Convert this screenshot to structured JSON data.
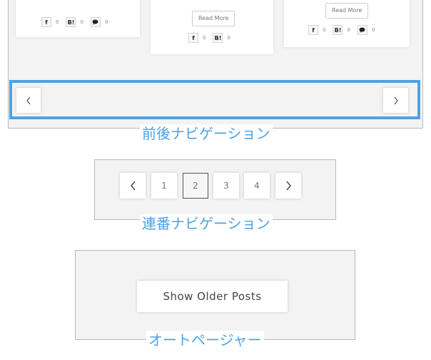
{
  "section_prev_next": {
    "caption": "前後ナビゲーション",
    "cards": [
      {
        "share": [
          {
            "icon": "f",
            "count": "0"
          },
          {
            "icon": "B!",
            "count": "0"
          },
          {
            "icon": "speech-bubble",
            "count": "0"
          }
        ]
      },
      {
        "read_more": "Read More",
        "share": [
          {
            "icon": "f",
            "count": "0"
          },
          {
            "icon": "B!",
            "count": "0"
          }
        ]
      },
      {
        "read_more": "Read More",
        "share": [
          {
            "icon": "f",
            "count": "0"
          },
          {
            "icon": "B!",
            "count": "0"
          },
          {
            "icon": "speech-bubble",
            "count": "0"
          }
        ]
      }
    ],
    "prev_icon": "chevron-left-icon",
    "next_icon": "chevron-right-icon",
    "highlight_color": "#4aa3e8"
  },
  "section_numbered": {
    "caption": "連番ナビゲーション",
    "pages": [
      "1",
      "2",
      "3",
      "4"
    ],
    "current_page": "2"
  },
  "section_autopager": {
    "caption": "オートページャー",
    "button_label": "Show Older Posts"
  },
  "colors": {
    "accent": "#4aa3e8",
    "panel": "#f3f3f3",
    "border": "#b9b9b9"
  }
}
